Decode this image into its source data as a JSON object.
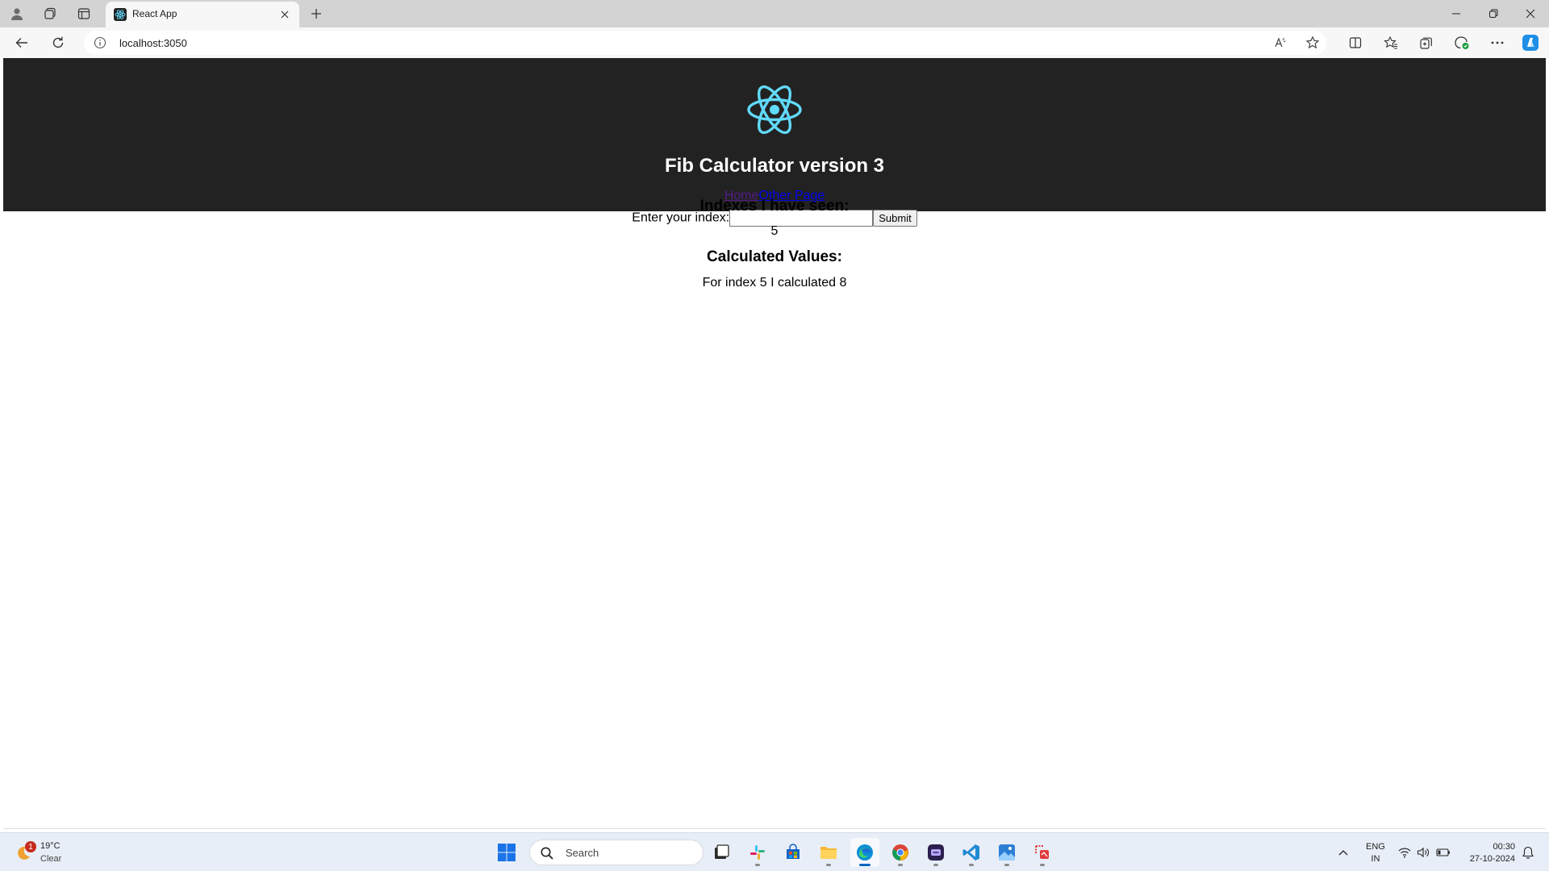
{
  "browser": {
    "tab_title": "React App",
    "address": "localhost:3050"
  },
  "app": {
    "title": "Fib Calculator version 3",
    "nav": {
      "home": "Home",
      "other": "Other Page"
    },
    "form": {
      "label": "Enter your index:",
      "input_value": "",
      "submit_label": "Submit"
    },
    "indexes_heading": "Indexes I have seen:",
    "indexes_text": "5",
    "calculated_heading": "Calculated Values:",
    "calculated_items": [
      "For index 5 I calculated 8"
    ]
  },
  "taskbar": {
    "weather": {
      "temp": "19°C",
      "condition": "Clear",
      "badge": "1"
    },
    "search_placeholder": "Search",
    "lang_line1": "ENG",
    "lang_line2": "IN",
    "time": "00:30",
    "date": "27-10-2024"
  },
  "colors": {
    "header_bg": "#222222",
    "react_blue": "#61dafb",
    "link_visited": "#551a8b",
    "link": "#0000ee"
  }
}
